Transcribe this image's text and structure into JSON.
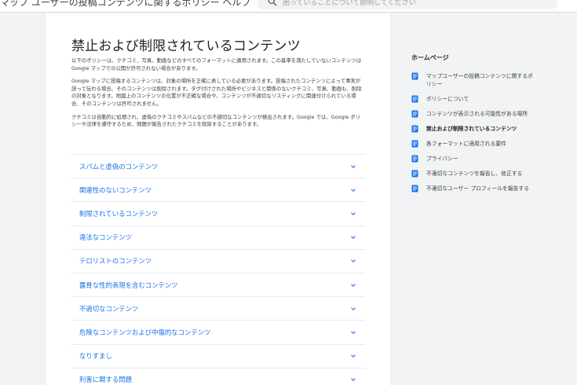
{
  "header": {
    "title": "マップ ユーザーの投稿コンテンツに関するポリシー ヘルプ",
    "search_placeholder": "困っていることについて説明してください"
  },
  "article": {
    "title": "禁止および制限されているコンテンツ",
    "paragraphs": [
      "以下のポリシーは、クチコミ、写真、動画などのすべてのフォーマットに適用されます。この基準を満たしていないコンテンツは Google マップでの公開が許可されない場合があります。",
      "Google マップに投稿するコンテンツは、対象の場所を正確に表している必要があります。投稿されたコンテンツによって事実が誤って伝わる場合、そのコンテンツは削除されます。タグ付けされた場所やビジネスと関係のないクチコミ、写真、動画も、削除の対象となります。地図上のコンテンツの位置が不正確な場合や、コンテンツが不適切なリスティングに関連付けられている場合、そのコンテンツは許可されません。",
      "クチコミは自動的に処理され、虚偽のクチコミやスパムなどの不適切なコンテンツが検出されます。Google では、Google ポリシーや法律を遵守するため、問題が報告されたクチコミを削除することがあります。"
    ],
    "accordion": [
      "スパムと虚偽のコンテンツ",
      "関連性のないコンテンツ",
      "制限されているコンテンツ",
      "違法なコンテンツ",
      "テロリストのコンテンツ",
      "露骨な性的表現を含むコンテンツ",
      "不適切なコンテンツ",
      "危険なコンテンツおよび中傷的なコンテンツ",
      "なりすまし",
      "利害に関する問題"
    ]
  },
  "sidebar": {
    "title": "ホームページ",
    "items": [
      {
        "label": "マップユーザーの投稿コンテンツに関するポリシー",
        "active": false
      },
      {
        "label": "ポリシーについて",
        "active": false
      },
      {
        "label": "コンテンツが表示される可能性がある場所",
        "active": false
      },
      {
        "label": "禁止および制限されているコンテンツ",
        "active": true
      },
      {
        "label": "各フォーマットに適用される要件",
        "active": false
      },
      {
        "label": "プライバシー",
        "active": false
      },
      {
        "label": "不適切なコンテンツを報告し、修正する",
        "active": false
      },
      {
        "label": "不適切なユーザー プロフィールを報告する",
        "active": false
      }
    ]
  },
  "icons": {
    "search": "search-icon",
    "accordion_toggle": "chevron-down-icon",
    "sidebar_doc": "article-icon"
  },
  "colors": {
    "link": "#1a73e8",
    "sidebar_icon": "#1a73e8",
    "divider": "#e8eaed",
    "page_bg": "#f1f3f4"
  }
}
